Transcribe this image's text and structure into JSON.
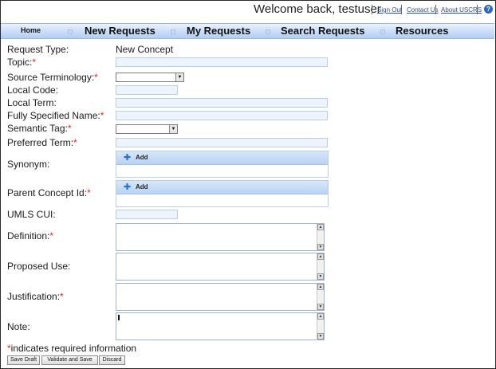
{
  "header": {
    "welcome": "Welcome back, testuser",
    "links": [
      "Sign Out",
      "Contact Us",
      "About USCRS"
    ],
    "help_icon": "?"
  },
  "nav": {
    "home": "Home",
    "items": [
      "New Requests",
      "My Requests",
      "Search Requests",
      "Resources"
    ]
  },
  "form": {
    "request_type_label": "Request Type:",
    "request_type_value": "New Concept",
    "topic_label": "Topic:",
    "source_terminology_label": "Source Terminology:",
    "local_code_label": "Local Code:",
    "local_term_label": "Local Term:",
    "fsn_label": "Fully Specified Name:",
    "semantic_tag_label": "Semantic Tag:",
    "preferred_term_label": "Preferred Term:",
    "synonym_label": "Synonym:",
    "parent_concept_label": "Parent Concept Id:",
    "umls_cui_label": "UMLS CUI:",
    "definition_label": "Definition:",
    "proposed_use_label": "Proposed Use:",
    "justification_label": "Justification:",
    "note_label": "Note:",
    "add_label": "Add",
    "required_marker": "*"
  },
  "footnote": {
    "marker": "*",
    "text": "indicates required information"
  },
  "buttons": {
    "save_draft": "Save Draft",
    "validate_save": "Validate and Save",
    "discard": "Discard"
  },
  "colors": {
    "required": "#e0271c",
    "nav_bg": "#c9ddf8",
    "input_bg": "#edf4fd",
    "link": "#2a4f8f"
  }
}
